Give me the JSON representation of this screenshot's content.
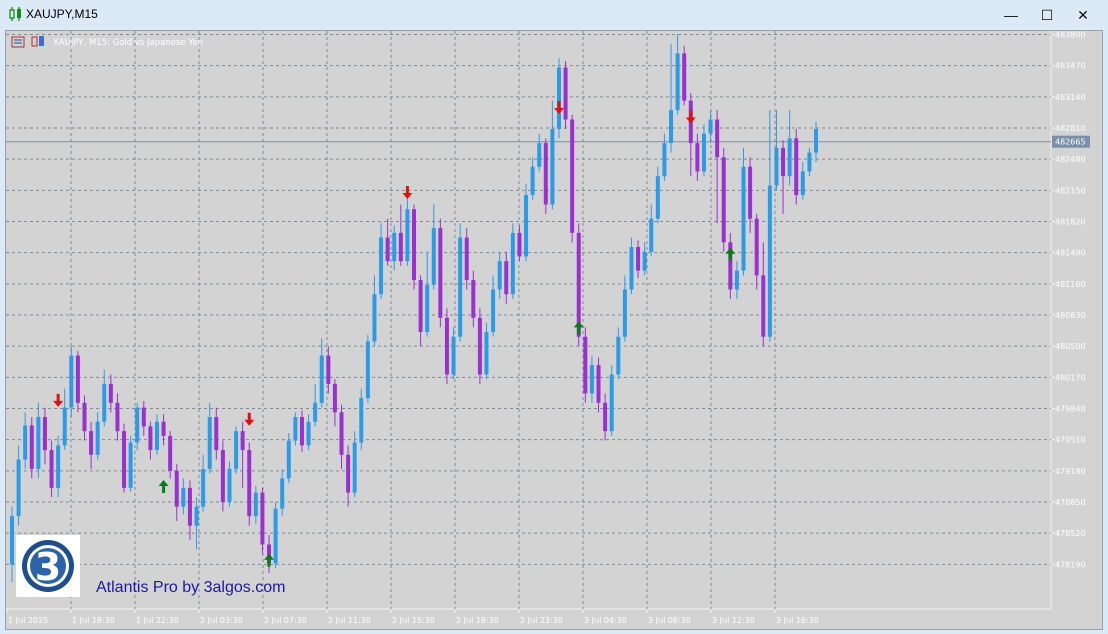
{
  "window": {
    "title": "XAUJPY,M15",
    "minimize_glyph": "—",
    "maximize_glyph": "☐",
    "close_glyph": "✕"
  },
  "chart_header": {
    "label": "XAUJPY, M15:  Gold vs Japanese Yen"
  },
  "current_price_label": "48266.5",
  "watermark_text": "Atlantis Pro by 3algos.com",
  "logo_text": "3",
  "colors": {
    "background": "#d3d3d3",
    "bull_candle": "#2b9be8",
    "bear_candle": "#9b30d0",
    "grid": "#7f8a94",
    "sell_arrow": "#e01010",
    "buy_arrow": "#0a7a1a",
    "price_line": "#7a8fa8",
    "price_tag": "#7a8fa8",
    "watermark": "#1a1a99"
  },
  "chart_data": {
    "type": "candlestick",
    "symbol": "XAUJPY",
    "timeframe": "M15",
    "y_ticks": [
      48380.0,
      48347.0,
      48314.0,
      48281.0,
      48248.0,
      48215.0,
      48182.0,
      48149.0,
      48116.0,
      48083.0,
      48050.0,
      48017.0,
      47984.0,
      47951.0,
      47918.0,
      47885.0,
      47852.0,
      47819.0
    ],
    "ylim": [
      47804.0,
      48380.0
    ],
    "x_ticks": [
      "1 Jul 2025",
      "1 Jul 18:30",
      "1 Jul 22:30",
      "2 Jul 03:30",
      "2 Jul 07:30",
      "2 Jul 11:30",
      "2 Jul 15:30",
      "2 Jul 19:30",
      "2 Jul 23:30",
      "3 Jul 04:30",
      "3 Jul 08:30",
      "3 Jul 12:30",
      "3 Jul 16:30"
    ],
    "grid": true,
    "price_line": 48266.5,
    "candles": [
      [
        47819,
        47870,
        47800,
        47880
      ],
      [
        47870,
        47930,
        47860,
        47945
      ],
      [
        47930,
        47966,
        47920,
        47980
      ],
      [
        47966,
        47920,
        47910,
        47975
      ],
      [
        47920,
        47975,
        47910,
        47990
      ],
      [
        47975,
        47940,
        47925,
        47985
      ],
      [
        47940,
        47900,
        47890,
        47950
      ],
      [
        47900,
        47945,
        47890,
        47955
      ],
      [
        47945,
        47985,
        47940,
        48005
      ],
      [
        47985,
        48040,
        47975,
        48050
      ],
      [
        48040,
        47990,
        47980,
        48045
      ],
      [
        47990,
        47960,
        47950,
        47998
      ],
      [
        47960,
        47935,
        47920,
        47970
      ],
      [
        47935,
        47970,
        47930,
        47980
      ],
      [
        47970,
        48010,
        47965,
        48025
      ],
      [
        48010,
        47990,
        47980,
        48020
      ],
      [
        47990,
        47960,
        47950,
        48000
      ],
      [
        47960,
        47900,
        47895,
        47968
      ],
      [
        47900,
        47948,
        47896,
        47955
      ],
      [
        47948,
        47985,
        47940,
        47990
      ],
      [
        47985,
        47965,
        47955,
        47992
      ],
      [
        47965,
        47940,
        47930,
        47970
      ],
      [
        47940,
        47970,
        47935,
        47978
      ],
      [
        47970,
        47955,
        47945,
        47978
      ],
      [
        47955,
        47918,
        47910,
        47960
      ],
      [
        47918,
        47880,
        47865,
        47925
      ],
      [
        47880,
        47900,
        47872,
        47910
      ],
      [
        47900,
        47860,
        47845,
        47908
      ],
      [
        47860,
        47880,
        47835,
        47890
      ],
      [
        47880,
        47920,
        47875,
        47935
      ],
      [
        47920,
        47975,
        47915,
        47990
      ],
      [
        47975,
        47940,
        47930,
        47985
      ],
      [
        47940,
        47885,
        47875,
        47950
      ],
      [
        47885,
        47920,
        47880,
        47928
      ],
      [
        47920,
        47960,
        47915,
        47965
      ],
      [
        47960,
        47940,
        47900,
        47970
      ],
      [
        47940,
        47870,
        47860,
        47948
      ],
      [
        47870,
        47895,
        47862,
        47902
      ],
      [
        47895,
        47840,
        47830,
        47900
      ],
      [
        47840,
        47820,
        47810,
        47850
      ],
      [
        47820,
        47878,
        47815,
        47885
      ],
      [
        47878,
        47910,
        47870,
        47920
      ],
      [
        47910,
        47950,
        47905,
        47958
      ],
      [
        47950,
        47975,
        47945,
        47980
      ],
      [
        47975,
        47945,
        47938,
        47982
      ],
      [
        47945,
        47970,
        47940,
        47978
      ],
      [
        47970,
        47990,
        47965,
        48010
      ],
      [
        47990,
        48040,
        47985,
        48058
      ],
      [
        48040,
        48010,
        48000,
        48050
      ],
      [
        48010,
        47980,
        47965,
        48015
      ],
      [
        47980,
        47935,
        47920,
        47988
      ],
      [
        47935,
        47895,
        47880,
        47945
      ],
      [
        47895,
        47948,
        47890,
        47960
      ],
      [
        47948,
        47995,
        47940,
        48005
      ],
      [
        47995,
        48055,
        47990,
        48062
      ],
      [
        48055,
        48105,
        48050,
        48125
      ],
      [
        48105,
        48165,
        48100,
        48180
      ],
      [
        48165,
        48140,
        48135,
        48185
      ],
      [
        48140,
        48170,
        48130,
        48178
      ],
      [
        48170,
        48140,
        48135,
        48200
      ],
      [
        48140,
        48195,
        48135,
        48210
      ],
      [
        48195,
        48120,
        48110,
        48200
      ],
      [
        48120,
        48065,
        48050,
        48125
      ],
      [
        48065,
        48115,
        48060,
        48150
      ],
      [
        48115,
        48175,
        48110,
        48200
      ],
      [
        48175,
        48080,
        48070,
        48185
      ],
      [
        48080,
        48020,
        48010,
        48090
      ],
      [
        48020,
        48060,
        48015,
        48070
      ],
      [
        48060,
        48165,
        48055,
        48180
      ],
      [
        48165,
        48120,
        48110,
        48175
      ],
      [
        48120,
        48080,
        48070,
        48130
      ],
      [
        48080,
        48020,
        48010,
        48090
      ],
      [
        48020,
        48065,
        48015,
        48075
      ],
      [
        48065,
        48110,
        48060,
        48125
      ],
      [
        48110,
        48140,
        48100,
        48150
      ],
      [
        48140,
        48105,
        48095,
        48150
      ],
      [
        48105,
        48170,
        48100,
        48180
      ],
      [
        48170,
        48145,
        48140,
        48178
      ],
      [
        48145,
        48210,
        48140,
        48222
      ],
      [
        48210,
        48240,
        48205,
        48250
      ],
      [
        48240,
        48265,
        48235,
        48275
      ],
      [
        48265,
        48200,
        48190,
        48270
      ],
      [
        48200,
        48280,
        48195,
        48310
      ],
      [
        48280,
        48345,
        48270,
        48355
      ],
      [
        48345,
        48290,
        48280,
        48352
      ],
      [
        48290,
        48170,
        48160,
        48295
      ],
      [
        48170,
        48060,
        48050,
        48180
      ],
      [
        48060,
        48000,
        47990,
        48070
      ],
      [
        48000,
        48030,
        47990,
        48040
      ],
      [
        48030,
        47990,
        47980,
        48038
      ],
      [
        47990,
        47960,
        47950,
        48000
      ],
      [
        47960,
        48020,
        47955,
        48030
      ],
      [
        48020,
        48060,
        48015,
        48070
      ],
      [
        48060,
        48110,
        48055,
        48125
      ],
      [
        48110,
        48155,
        48105,
        48165
      ],
      [
        48155,
        48130,
        48122,
        48162
      ],
      [
        48130,
        48150,
        48125,
        48160
      ],
      [
        48150,
        48185,
        48145,
        48200
      ],
      [
        48185,
        48230,
        48180,
        48240
      ],
      [
        48230,
        48265,
        48225,
        48275
      ],
      [
        48265,
        48300,
        48255,
        48370
      ],
      [
        48300,
        48360,
        48295,
        48380
      ],
      [
        48360,
        48310,
        48305,
        48368
      ],
      [
        48310,
        48265,
        48230,
        48318
      ],
      [
        48265,
        48235,
        48225,
        48275
      ],
      [
        48235,
        48275,
        48230,
        48285
      ],
      [
        48275,
        48290,
        48265,
        48300
      ],
      [
        48290,
        48250,
        48180,
        48300
      ],
      [
        48250,
        48160,
        48150,
        48260
      ],
      [
        48160,
        48110,
        48100,
        48170
      ],
      [
        48110,
        48130,
        48100,
        48140
      ],
      [
        48130,
        48240,
        48125,
        48260
      ],
      [
        48240,
        48185,
        48170,
        48250
      ],
      [
        48185,
        48125,
        48110,
        48190
      ],
      [
        48125,
        48060,
        48050,
        48160
      ],
      [
        48060,
        48220,
        48055,
        48300
      ],
      [
        48220,
        48260,
        48215,
        48300
      ],
      [
        48260,
        48230,
        48190,
        48268
      ],
      [
        48230,
        48270,
        48220,
        48300
      ],
      [
        48270,
        48210,
        48200,
        48280
      ],
      [
        48210,
        48235,
        48205,
        48245
      ],
      [
        48235,
        48255,
        48230,
        48260
      ],
      [
        48255,
        48280,
        48245,
        48288
      ]
    ],
    "signals": [
      {
        "type": "sell",
        "index": 7,
        "price": 47990
      },
      {
        "type": "buy",
        "index": 23,
        "price": 47904
      },
      {
        "type": "sell",
        "index": 36,
        "price": 47970
      },
      {
        "type": "buy",
        "index": 39,
        "price": 47826
      },
      {
        "type": "sell",
        "index": 60,
        "price": 48210
      },
      {
        "type": "sell",
        "index": 83,
        "price": 48300
      },
      {
        "type": "buy",
        "index": 86,
        "price": 48072
      },
      {
        "type": "sell",
        "index": 103,
        "price": 48290
      },
      {
        "type": "buy",
        "index": 109,
        "price": 48150
      }
    ]
  }
}
